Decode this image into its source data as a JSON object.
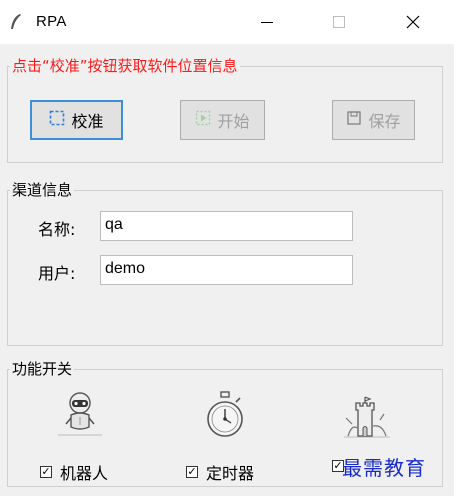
{
  "window": {
    "title": "RPA",
    "icon": "feather-icon",
    "controls": [
      "minimize-icon",
      "maximize-icon",
      "close-icon"
    ]
  },
  "calibration_group": {
    "title": "点击“校准”按钮获取软件位置信息",
    "title_color": "#ff1a1a",
    "buttons": {
      "calibrate_label": "校准",
      "start_label": "开始",
      "save_label": "保存"
    }
  },
  "channel_group": {
    "title": "渠道信息",
    "name_label": "名称:",
    "name_value": "qa",
    "user_label": "用户:",
    "user_value": "demo"
  },
  "feature_group": {
    "title": "功能开关",
    "toggles": [
      {
        "label": "机器人",
        "checked": true,
        "icon": "robot-icon"
      },
      {
        "label": "定时器",
        "checked": true,
        "icon": "stopwatch-icon"
      },
      {
        "label": "",
        "checked": true,
        "icon": "castle-icon"
      }
    ]
  },
  "watermark": "最需教育",
  "colors": {
    "accent": "#3c8fd8",
    "warning_text": "#ff1a1a",
    "watermark": "#1a2bcc"
  }
}
